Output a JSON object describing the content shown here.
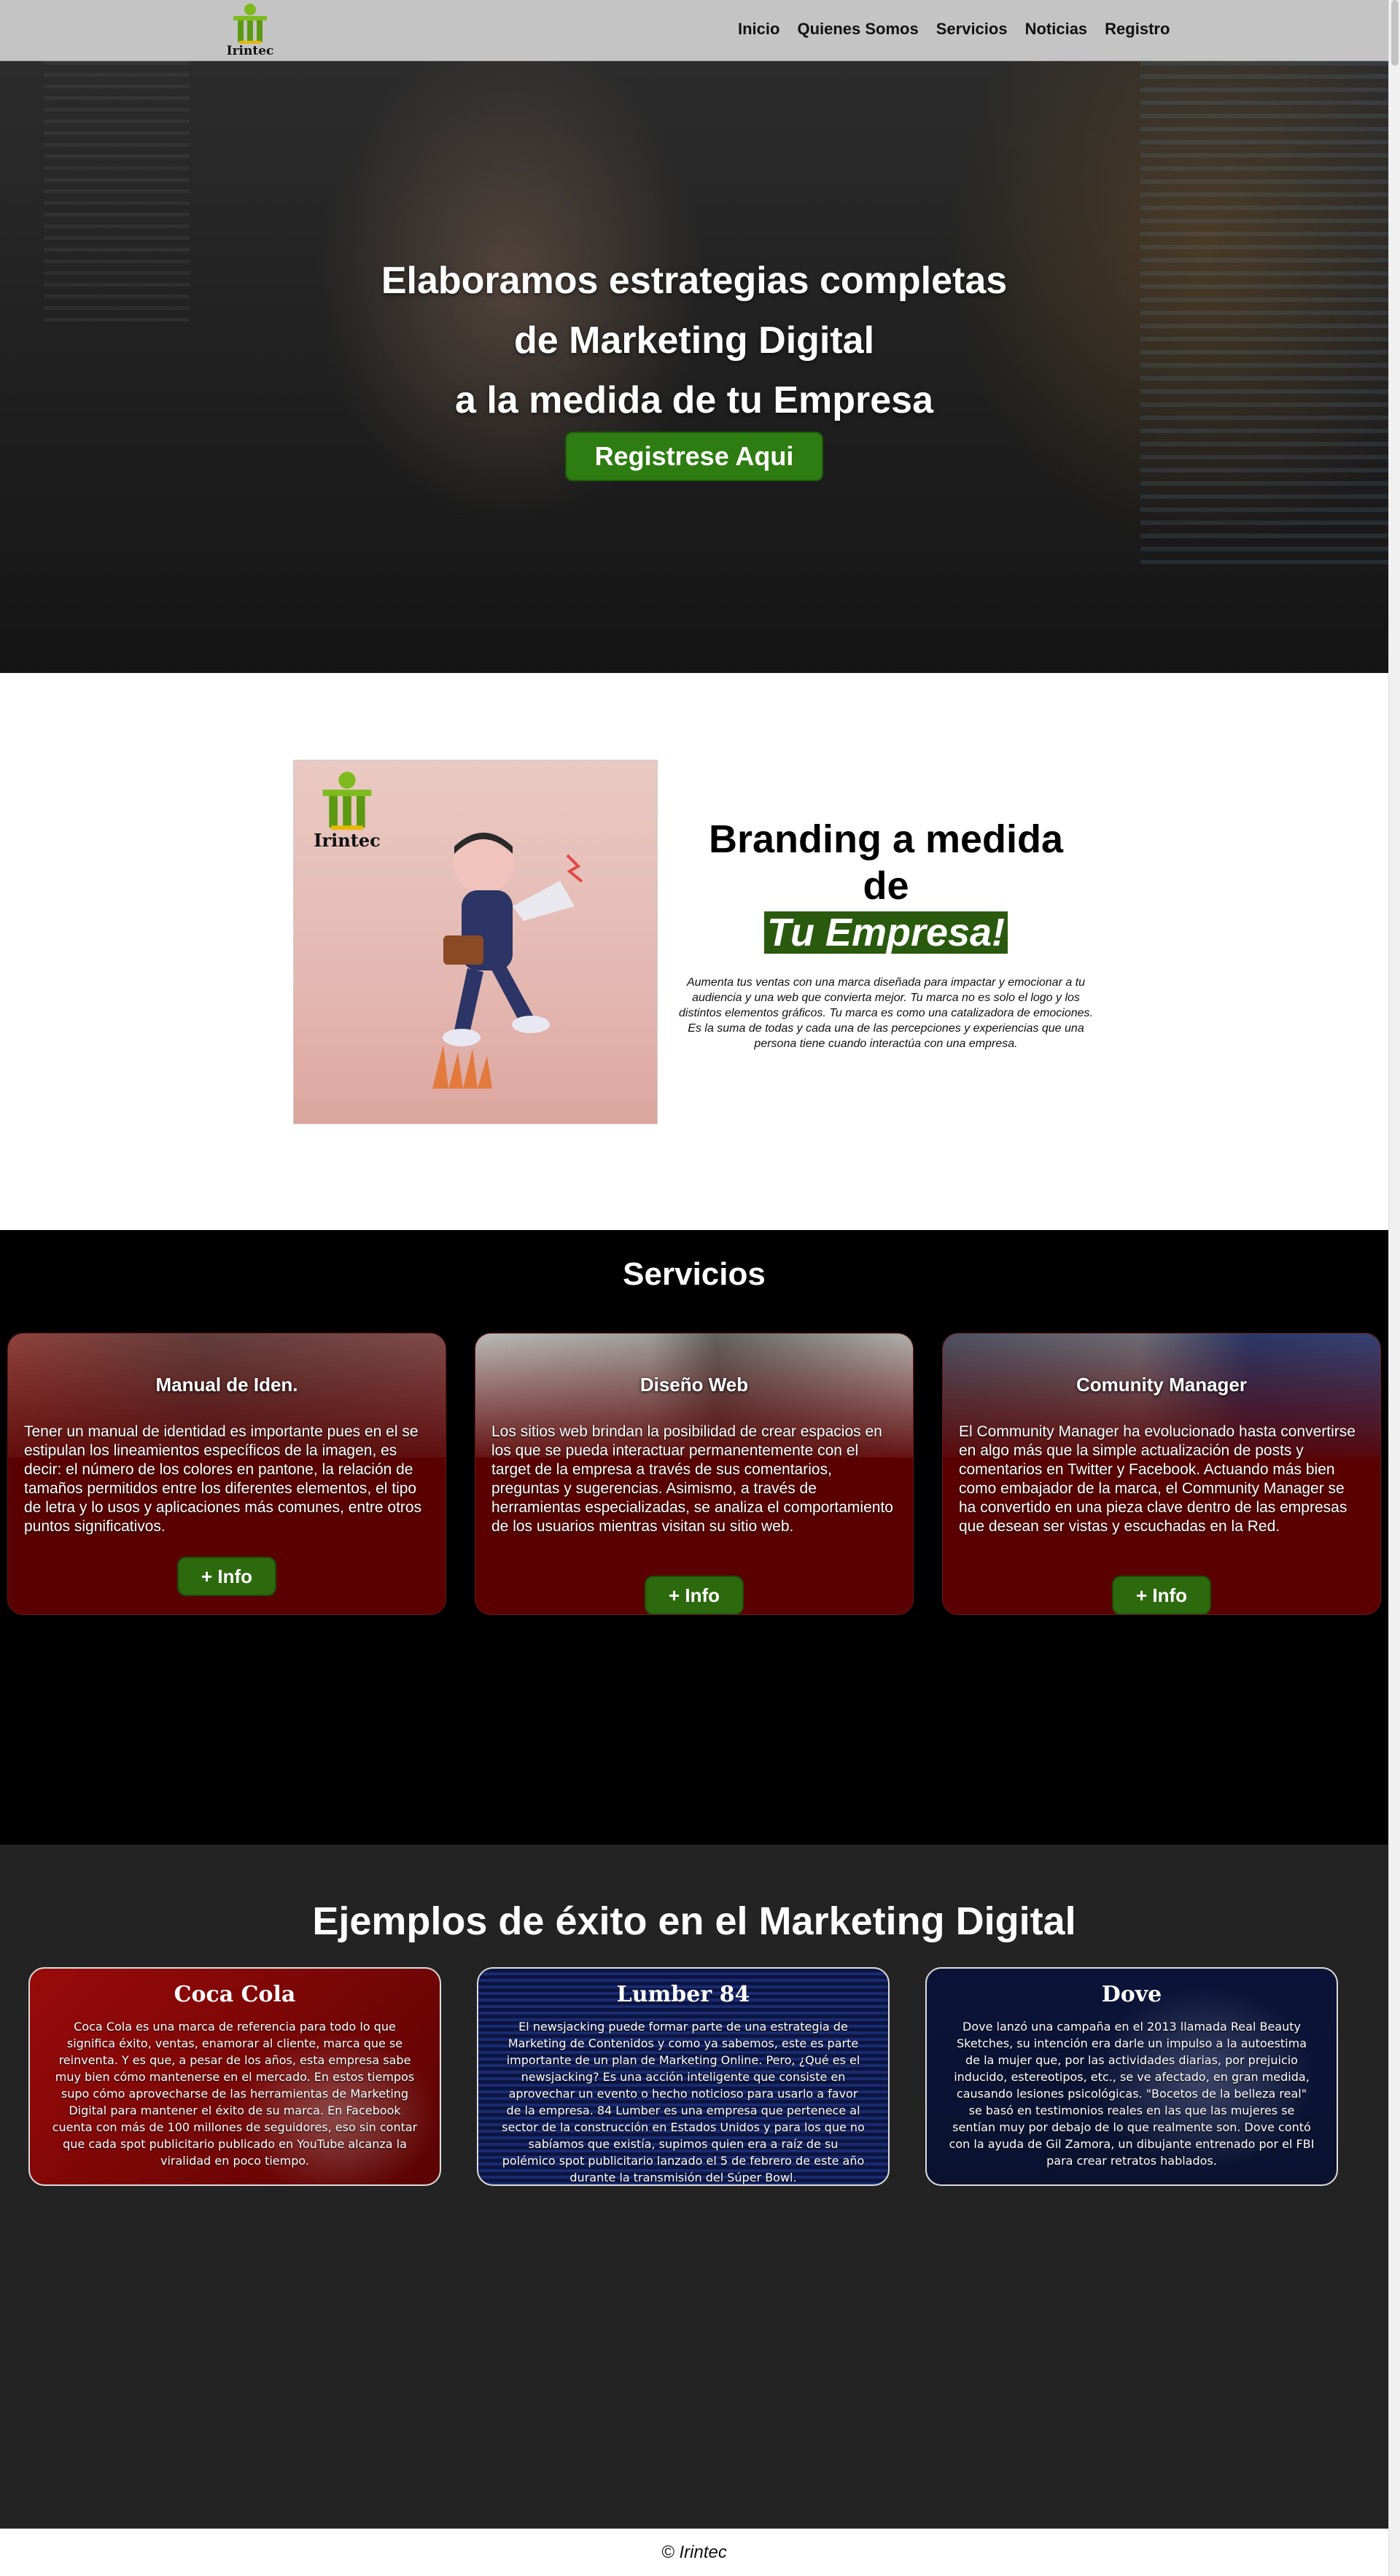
{
  "navbar": {
    "logo_text": "Irintec",
    "links": [
      "Inicio",
      "Quienes Somos",
      "Servicios",
      "Noticias",
      "Registro"
    ]
  },
  "hero": {
    "title_lines": [
      "Elaboramos estrategias completas",
      "de Marketing Digital",
      "a la medida de tu Empresa"
    ],
    "cta_label": "Registrese Aqui"
  },
  "branding": {
    "image_logo_text": "Irintec",
    "title_line1": "Branding a medida",
    "title_line2": "de",
    "title_highlight": "Tu Empresa!",
    "description": "Aumenta tus ventas con una marca diseñada para impactar y emocionar a tu audiencia y una web que convierta mejor. Tu marca no es solo el logo y los distintos elementos gráficos. Tu marca es como una catalizadora de emociones. Es la suma de todas y cada una de las percepciones y experiencias que una persona tiene cuando interactúa con una empresa."
  },
  "servicios": {
    "title": "Servicios",
    "cards": [
      {
        "title": "Manual de Iden.",
        "text": "Tener un manual de identidad es importante pues en el se estipulan los lineamientos específicos de la imagen, es decir: el número de los colores en pantone, la relación de tamaños permitidos entre los diferentes elementos, el tipo de letra y lo usos y aplicaciones más comunes, entre otros puntos significativos.",
        "button": "+ Info"
      },
      {
        "title": "Diseño Web",
        "text": "Los sitios web brindan la posibilidad de crear espacios en los que se pueda interactuar permanentemente con el target de la empresa a través de sus comentarios, preguntas y sugerencias. Asimismo, a través de herramientas especializadas, se analiza el comportamiento de los usuarios mientras visitan su sitio web.",
        "button": "+ Info"
      },
      {
        "title": "Comunity Manager",
        "text": "El Community Manager ha evolucionado hasta convertirse en algo más que la simple actualización de posts y comentarios en Twitter y Facebook. Actuando más bien como embajador de la marca, el Community Manager se ha convertido en una pieza clave dentro de las empresas que desean ser vistas y escuchadas en la Red.",
        "button": "+ Info"
      }
    ]
  },
  "ejemplos": {
    "title": "Ejemplos de éxito en el Marketing Digital",
    "cards": [
      {
        "title": "Coca Cola",
        "text": "Coca Cola es una marca de referencia para todo lo que significa éxito, ventas, enamorar al cliente, marca que se reinventa. Y es que, a pesar de los años, esta empresa sabe muy bien cómo mantenerse en el mercado. En estos tiempos supo cómo aprovecharse de las herramientas de Marketing Digital para mantener el éxito de su marca. En Facebook cuenta con más de 100 millones de seguidores, eso sin contar que cada spot publicitario publicado en YouTube alcanza la viralidad en poco tiempo."
      },
      {
        "title": "Lumber 84",
        "text": "El newsjacking puede formar parte de una estrategia de Marketing de Contenidos y como ya sabemos, este es parte importante de un plan de Marketing Online. Pero, ¿Qué es el newsjacking? Es una acción inteligente que consiste en aprovechar un evento o hecho noticioso para usarlo a favor de la empresa. 84 Lumber es una empresa que pertenece al sector de la construcción en Estados Unidos y para los que no sabíamos que existía, supimos quien era a raíz de su polémico spot publicitario lanzado el 5 de febrero de este año durante la transmisión del Súper Bowl."
      },
      {
        "title": "Dove",
        "text": "Dove lanzó una campaña en el 2013 llamada Real Beauty Sketches, su intención era darle un impulso a la autoestima de la mujer que, por las actividades diarias, por prejuicio inducido, estereotipos, etc., se ve afectado, en gran medida, causando lesiones psicológicas. \"Bocetos de la belleza real\" se basó en testimonios reales en las que las mujeres se sentían muy por debajo de lo que realmente son. Dove contó con la ayuda de Gil Zamora, un dibujante entrenado por el FBI para crear retratos hablados."
      }
    ]
  },
  "footer": {
    "text": "© Irintec"
  },
  "colors": {
    "navbar_bg": "#c4c4c4",
    "accent_green": "#2e7d12",
    "card_red": "#5a0000",
    "servicios_bg": "#000000",
    "ejemplos_bg": "#232323"
  }
}
